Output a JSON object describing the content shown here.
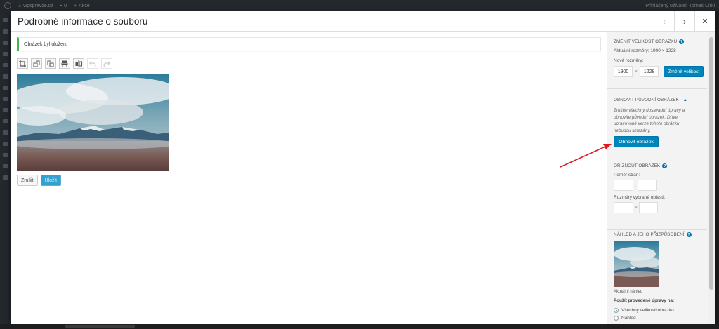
{
  "admin_bar": {
    "site_name": "wpspravce.cz",
    "comments_count": "0",
    "new_label": "Akce",
    "user_greeting": "Přihlášený uživatel: Tomas Cirkl"
  },
  "modal": {
    "title": "Podrobné informace o souboru",
    "prev_icon": "‹",
    "next_icon": "›",
    "close_icon": "✕"
  },
  "editor": {
    "notice": "Obrázek byl uložen.",
    "tools": [
      {
        "name": "crop-icon"
      },
      {
        "name": "rotate-left-icon"
      },
      {
        "name": "rotate-right-icon"
      },
      {
        "name": "flip-vertical-icon"
      },
      {
        "name": "flip-horizontal-icon"
      },
      {
        "name": "undo-icon"
      },
      {
        "name": "redo-icon"
      }
    ],
    "cancel_label": "Zrušit",
    "save_label": "Uložit"
  },
  "sidebar": {
    "scale": {
      "title": "Změnit velikost obrázku",
      "current_dimensions": "Aktuální rozměry: 1900 × 1228",
      "new_dimensions_label": "Nové rozměry:",
      "width_value": "1900",
      "times": "×",
      "height_value": "1228",
      "button_label": "Změnit velikost"
    },
    "restore": {
      "title": "Obnovit původní obrázek",
      "description": "Zrušíte všechny dosavadní úpravy a obnovíte původní obrázek. Dříve upravované verze tohoto obrázku nebudou smazány.",
      "button_label": "Obnovit obrázek"
    },
    "crop": {
      "title": "Oříznout obrázek",
      "aspect_label": "Poměr stran:",
      "aspect_sep": ":",
      "selection_label": "Rozměry vybrané oblasti:",
      "selection_sep": "×"
    },
    "thumbnail": {
      "title": "Náhled a jeho přizpůsobení",
      "current_label": "Aktuální náhled",
      "apply_label": "Použít provedené úpravy na:",
      "options": [
        "Všechny velikosti obrázku",
        "Náhled"
      ],
      "selected_option": "Všechny velikosti obrázku"
    }
  },
  "colors": {
    "primary": "#0085ba",
    "notice_success": "#46b450",
    "annotation_arrow": "#e0191d"
  }
}
